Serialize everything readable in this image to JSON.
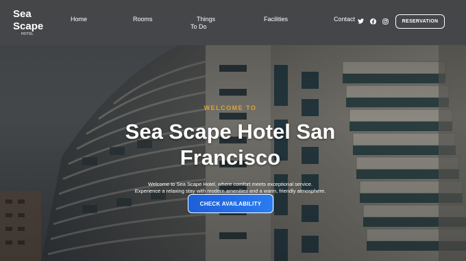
{
  "header": {
    "logo": {
      "line1": "Sea",
      "line2": "Scape",
      "sub": "HOTEL"
    },
    "nav": [
      {
        "label": "Home"
      },
      {
        "label": "Rooms"
      },
      {
        "label": "Things To Do",
        "line1": "Things",
        "line2": "To Do"
      },
      {
        "label": "Facilities"
      },
      {
        "label": "Contact"
      }
    ],
    "social": [
      {
        "icon": "twitter-icon"
      },
      {
        "icon": "facebook-icon"
      },
      {
        "icon": "instagram-icon"
      }
    ],
    "reservation_label": "RESERVATION"
  },
  "hero": {
    "welcome": "WELCOME TO",
    "title": "Sea Scape Hotel San Francisco",
    "description_line1": "Welcome to Sea Scape Hotel, where comfort meets exceptional service.",
    "description_line2": "Experience a relaxing stay with modern amenities and a warm, friendly atmosphere.",
    "cta_label": "CHECK AVAILABILITY"
  },
  "colors": {
    "accent_gold": "#e0a42e",
    "cta_blue": "#1e5fd9",
    "header_bg": "#46484a"
  }
}
